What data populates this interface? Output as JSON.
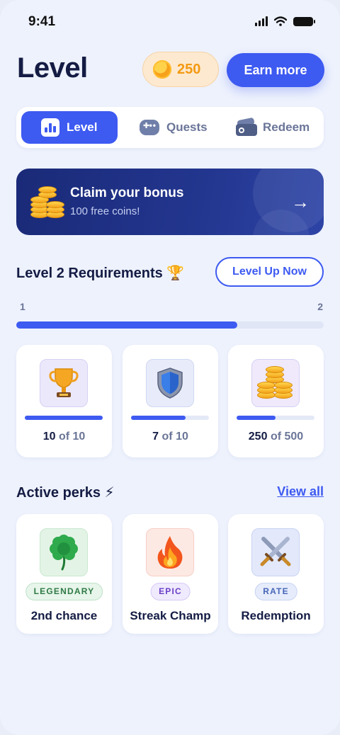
{
  "status": {
    "time": "9:41"
  },
  "header": {
    "title": "Level",
    "coins": "250",
    "earn_label": "Earn more"
  },
  "tabs": [
    {
      "label": "Level",
      "icon": "chart-icon",
      "active": true
    },
    {
      "label": "Quests",
      "icon": "gamepad-icon",
      "active": false
    },
    {
      "label": "Redeem",
      "icon": "wallet-icon",
      "active": false
    }
  ],
  "banner": {
    "title": "Claim your bonus",
    "subtitle": "100 free coins!"
  },
  "requirements": {
    "title": "Level 2 Requirements",
    "emoji": "🏆",
    "levelup_label": "Level Up Now",
    "from": "1",
    "to": "2",
    "progress": 0.72,
    "items": [
      {
        "icon": "trophy-icon",
        "current": "10",
        "of": "of",
        "target": "10",
        "progress": 1.0
      },
      {
        "icon": "shield-icon",
        "current": "7",
        "of": "of",
        "target": "10",
        "progress": 0.7
      },
      {
        "icon": "coins-icon",
        "current": "250",
        "of": "of",
        "target": "500",
        "progress": 0.5
      }
    ]
  },
  "perks": {
    "title": "Active perks",
    "emoji": "⚡",
    "viewall_label": "View all",
    "items": [
      {
        "icon": "clover-icon",
        "badge": "LEGENDARY",
        "name": "2nd chance"
      },
      {
        "icon": "fire-icon",
        "badge": "EPIC",
        "name": "Streak Champ"
      },
      {
        "icon": "swords-icon",
        "badge": "RATE",
        "name": "Redemption"
      }
    ]
  },
  "colors": {
    "accent": "#3d5af1",
    "background": "#eef2fd",
    "banner": "#1f2f86",
    "coin": "#f39a12"
  }
}
